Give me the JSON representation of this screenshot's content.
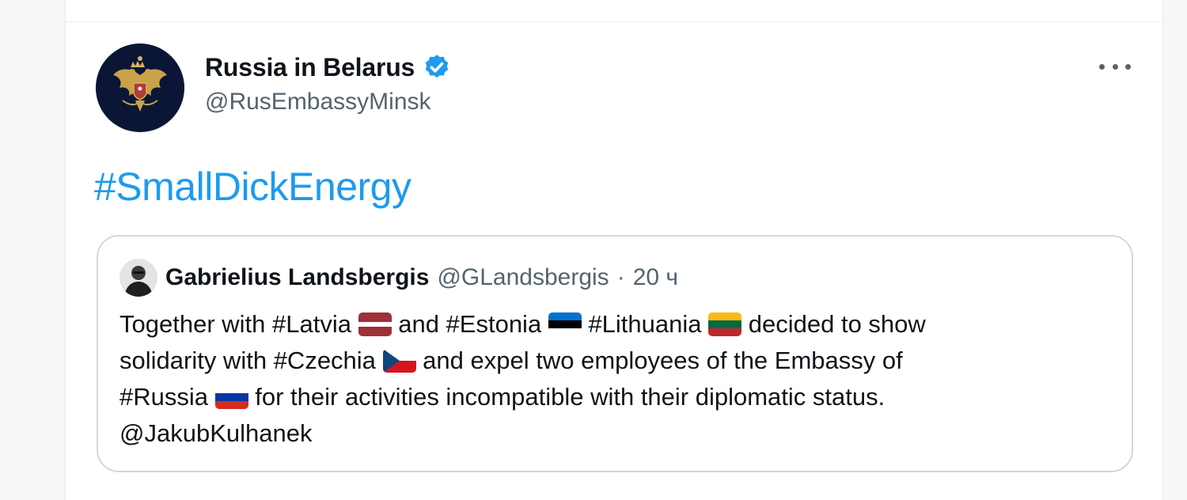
{
  "author": {
    "display_name": "Russia in Belarus",
    "handle": "@RusEmbassyMinsk",
    "verified": true,
    "avatar_icon": "coat-of-arms-icon"
  },
  "tweet": {
    "text": "#SmallDickEnergy"
  },
  "more_icon": "more-horizontal-icon",
  "quoted_tweet": {
    "author_name": "Gabrielius Landsbergis",
    "author_handle": "@GLandsbergis",
    "separator": "·",
    "time": "20 ч",
    "text_parts": {
      "l1_a": "Together with ",
      "l1_tag1": "#Latvia",
      "l1_b": " and ",
      "l1_tag2": "#Estonia",
      "l1_tag3": "#Lithuania",
      "l1_c": " decided to show",
      "l2_a": "solidarity with ",
      "l2_tag": "#Czechia",
      "l2_b": " and expel two employees of the Embassy of",
      "l3_tag": "#Russia",
      "l3_b": " for their activities incompatible with their diplomatic status.",
      "l4_mention": "@JakubKulhanek"
    },
    "flags": [
      "latvia-flag-icon",
      "estonia-flag-icon",
      "lithuania-flag-icon",
      "czechia-flag-icon",
      "russia-flag-icon"
    ]
  },
  "colors": {
    "link": "#1d9bf0",
    "text": "#0f1419",
    "secondary": "#536471",
    "border": "#cfd9de",
    "avatar_bg": "#0b1637"
  }
}
